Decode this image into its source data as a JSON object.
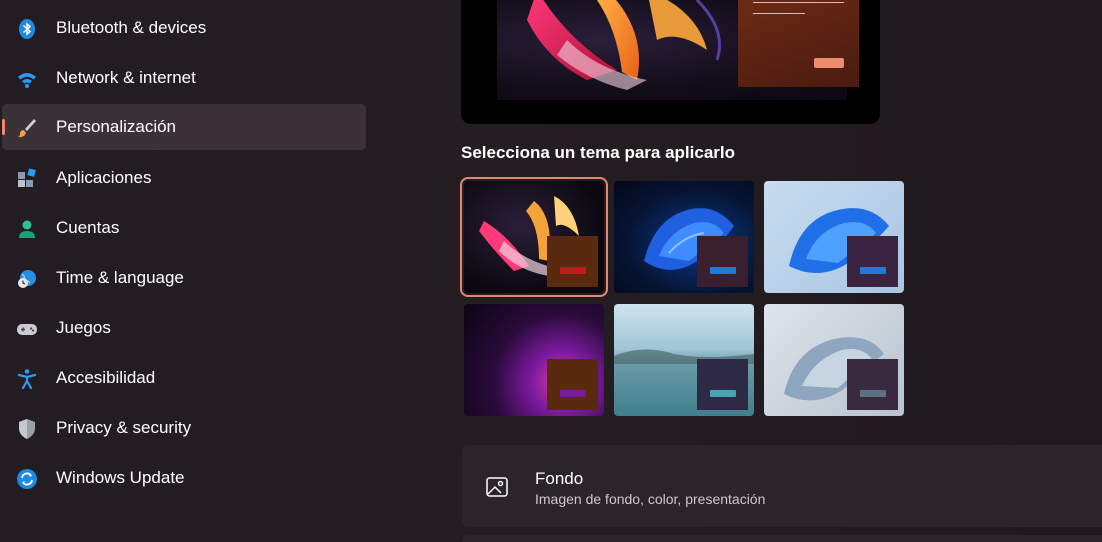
{
  "sidebar": {
    "items": [
      {
        "label": "Bluetooth & devices",
        "icon": "bluetooth-icon"
      },
      {
        "label": "Network & internet",
        "icon": "wifi-icon"
      },
      {
        "label": "Personalización",
        "icon": "brush-icon",
        "selected": true
      },
      {
        "label": "Aplicaciones",
        "icon": "apps-icon"
      },
      {
        "label": "Cuentas",
        "icon": "person-icon"
      },
      {
        "label": "Time & language",
        "icon": "globe-clock-icon"
      },
      {
        "label": "Juegos",
        "icon": "gamepad-icon"
      },
      {
        "label": "Accesibilidad",
        "icon": "accessibility-icon"
      },
      {
        "label": "Privacy & security",
        "icon": "shield-icon"
      },
      {
        "label": "Windows Update",
        "icon": "sync-icon"
      }
    ]
  },
  "themes": {
    "title": "Selecciona un tema para aplicarlo",
    "items": [
      {
        "name": "glow-dark",
        "accent": "#c41a1a",
        "selected": true
      },
      {
        "name": "bloom-dark",
        "accent": "#1e7ad6"
      },
      {
        "name": "bloom-light",
        "accent": "#1e7ad6"
      },
      {
        "name": "captured-motion",
        "accent": "#7a1a9e"
      },
      {
        "name": "flow-lake",
        "accent": "#4aa3b8"
      },
      {
        "name": "sunrise-light",
        "accent": "#5d6f80"
      }
    ]
  },
  "fondo": {
    "title": "Fondo",
    "subtitle": "Imagen de fondo, color, presentación"
  },
  "colors": {
    "accent": "#f0866c",
    "selected_bg": "#3a3237",
    "card_bg": "#2b2529"
  }
}
